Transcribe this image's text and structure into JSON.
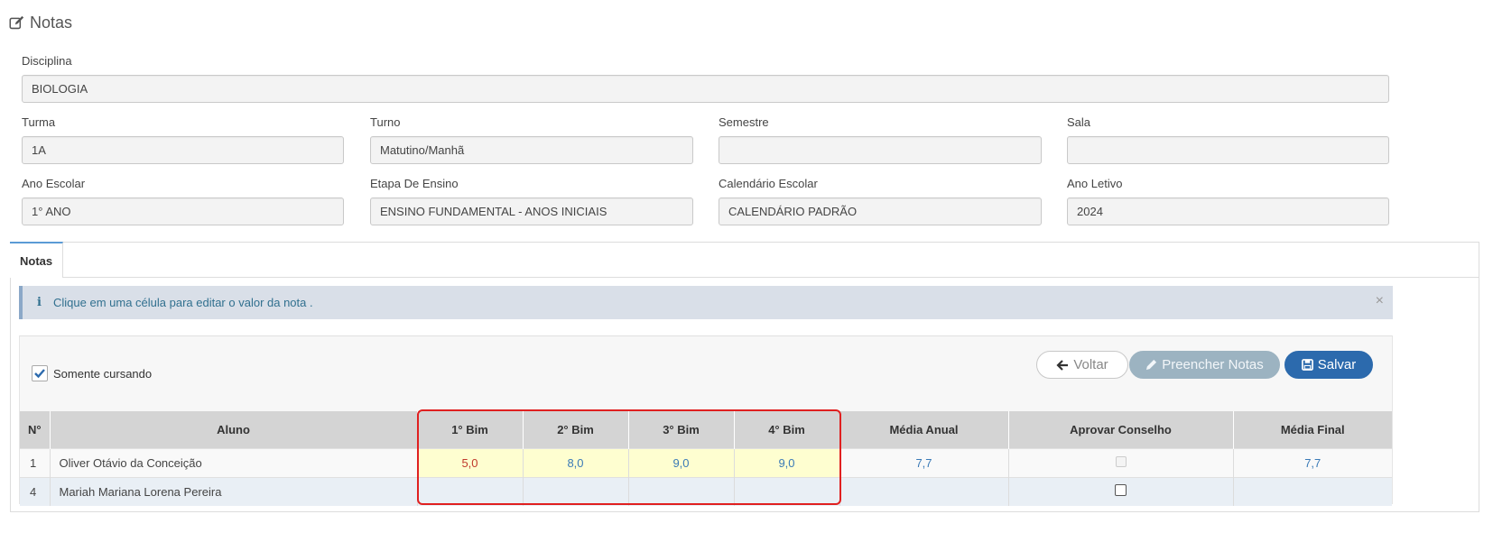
{
  "page": {
    "title": "Notas",
    "icon": "edit-icon"
  },
  "form": {
    "disciplina": {
      "label": "Disciplina",
      "value": "BIOLOGIA"
    },
    "turma": {
      "label": "Turma",
      "value": "1A"
    },
    "turno": {
      "label": "Turno",
      "value": "Matutino/Manhã"
    },
    "semestre": {
      "label": "Semestre",
      "value": ""
    },
    "sala": {
      "label": "Sala",
      "value": ""
    },
    "ano_escolar": {
      "label": "Ano Escolar",
      "value": "1° ANO"
    },
    "etapa": {
      "label": "Etapa De Ensino",
      "value": "ENSINO FUNDAMENTAL - ANOS INICIAIS"
    },
    "calendario": {
      "label": "Calendário Escolar",
      "value": "CALENDÁRIO PADRÃO"
    },
    "ano_letivo": {
      "label": "Ano Letivo",
      "value": "2024"
    }
  },
  "tabs": [
    {
      "label": "Notas",
      "active": true
    }
  ],
  "alert": {
    "text": "Clique em uma célula para editar o valor da nota .",
    "close": "×"
  },
  "filter": {
    "label": "Somente cursando",
    "checked": true
  },
  "buttons": {
    "voltar": "Voltar",
    "preencher": "Preencher Notas",
    "salvar": "Salvar"
  },
  "table": {
    "headers": {
      "num": "N°",
      "aluno": "Aluno",
      "b1": "1° Bim",
      "b2": "2° Bim",
      "b3": "3° Bim",
      "b4": "4° Bim",
      "media_anual": "Média Anual",
      "aprovar": "Aprovar Conselho",
      "media_final": "Média Final"
    },
    "rows": [
      {
        "num": "1",
        "aluno": "Oliver Otávio da Conceição",
        "b1": "5,0",
        "b2": "8,0",
        "b3": "9,0",
        "b4": "9,0",
        "media_anual": "7,7",
        "media_final": "7,7"
      },
      {
        "num": "4",
        "aluno": "Mariah Mariana Lorena Pereira",
        "b1": "",
        "b2": "",
        "b3": "",
        "b4": "",
        "media_anual": "",
        "media_final": ""
      }
    ]
  },
  "colors": {
    "primary": "#2c6aad",
    "muted_button": "#9cb3c1",
    "highlight": "#fefed0",
    "grade_low": "#c0392b",
    "grade": "#3a7ab7",
    "annotation": "#e02020"
  }
}
